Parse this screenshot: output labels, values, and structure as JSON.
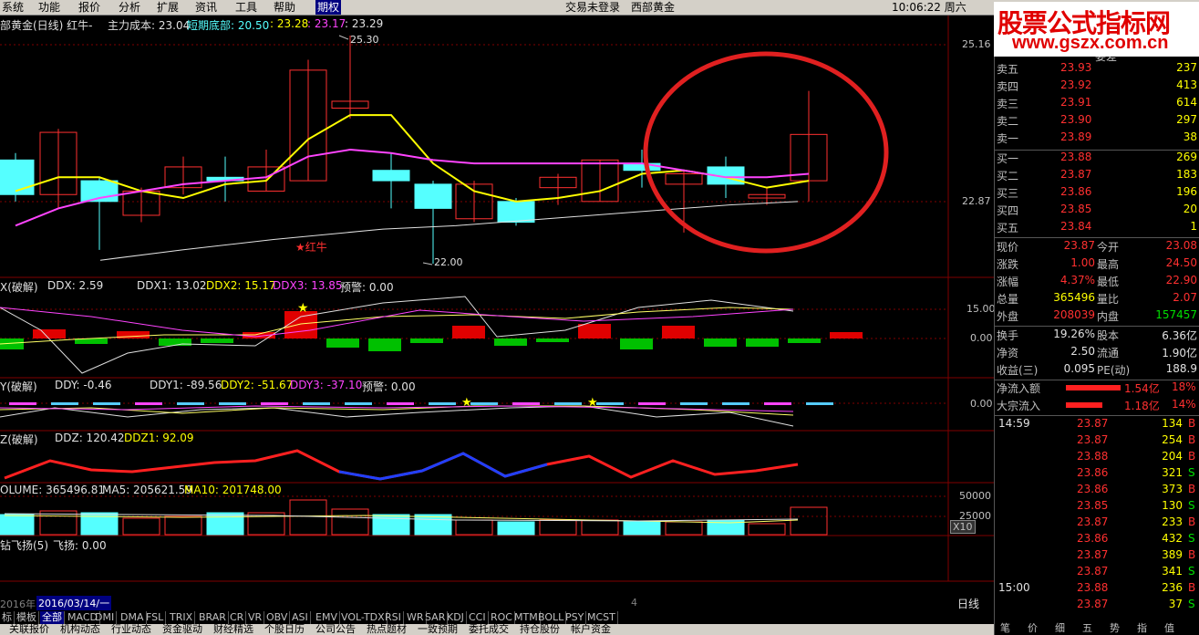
{
  "menu": {
    "items": [
      "系统",
      "功能",
      "报价",
      "分析",
      "扩展",
      "资讯",
      "工具",
      "帮助",
      "期权"
    ],
    "status": "交易未登录",
    "stock_name": "西部黄金",
    "clock": "10:06:22 周六"
  },
  "watermark": {
    "title": "股票公式指标网",
    "url": "www.gszx.com.cn"
  },
  "main_chart": {
    "title": "部黄金(日线) 红牛-",
    "cost_label": "主力成本: 23.04",
    "short_bottom_label": "短期底部: 20.50",
    "val3": ": 23.28",
    "val4": ": 23.17",
    "val5": ": 23.29",
    "high_marker": "25.30",
    "low_marker": "22.00",
    "signal_label": "★红牛",
    "axis_top": "25.16",
    "axis_mid": "22.87"
  },
  "ddx": {
    "title": "X(破解)",
    "ddx": "DDX: 2.59",
    "ddx1": "DDX1: 13.02",
    "ddx2": "DDX2: 15.17",
    "ddx3": "DDX3: 13.85",
    "warn": "预警: 0.00",
    "axis_a": "15.00",
    "axis_b": "0.00"
  },
  "ddy": {
    "title": "Y(破解)",
    "ddy": "DDY: -0.46",
    "ddy1": "DDY1: -89.56",
    "ddy2": "DDY2: -51.67",
    "ddy3": "DDY3: -37.10",
    "warn": "预警: 0.00",
    "axis_a": "0.00"
  },
  "ddz": {
    "title": "Z(破解)",
    "ddz": "DDZ: 120.42",
    "ddz1": "DDZ1: 92.09"
  },
  "volume": {
    "label": "OLUME: 365496.81",
    "ma5": "MA5: 205621.59",
    "ma10": "MA10: 201748.00",
    "axis_a": "50000",
    "axis_b": "25000",
    "axis_unit": "X10"
  },
  "feiyang": {
    "label": "钻飞扬(5)",
    "val": "飞扬: 0.00"
  },
  "date_bar": {
    "left": "2016年",
    "date": "2016/03/14/一",
    "mid": "4",
    "period": "日线"
  },
  "tabs": [
    "标",
    "模板",
    "全部",
    "MACD",
    "DMI",
    "DMA",
    "FSL",
    "TRIX",
    "BRAR",
    "CR",
    "VR",
    "OBV",
    "ASI",
    "EMV",
    "VOL-TDX",
    "RSI",
    "WR",
    "SAR",
    "KDJ",
    "CCI",
    "ROC",
    "MTM",
    "BOLL",
    "PSY",
    "MCST"
  ],
  "bottom_items": [
    "关联报价",
    "机构动态",
    "行业动态",
    "资金驱动",
    "财经精选",
    "个股日历",
    "公司公告",
    "热点题材",
    "一致预期",
    "委托成交",
    "持仓股份",
    "帐户资金"
  ],
  "order_book": {
    "header": "委差",
    "sell": [
      {
        "label": "卖五",
        "price": "23.93",
        "vol": "237"
      },
      {
        "label": "卖四",
        "price": "23.92",
        "vol": "413"
      },
      {
        "label": "卖三",
        "price": "23.91",
        "vol": "614"
      },
      {
        "label": "卖二",
        "price": "23.90",
        "vol": "297"
      },
      {
        "label": "卖一",
        "price": "23.89",
        "vol": "38"
      }
    ],
    "buy": [
      {
        "label": "买一",
        "price": "23.88",
        "vol": "269"
      },
      {
        "label": "买二",
        "price": "23.87",
        "vol": "183"
      },
      {
        "label": "买三",
        "price": "23.86",
        "vol": "196"
      },
      {
        "label": "买四",
        "price": "23.85",
        "vol": "20"
      },
      {
        "label": "买五",
        "price": "23.84",
        "vol": "1"
      }
    ]
  },
  "quote": [
    {
      "l1": "现价",
      "v1": "23.87",
      "l2": "今开",
      "v2": "23.08",
      "c1": "red",
      "c2": "red"
    },
    {
      "l1": "涨跌",
      "v1": "1.00",
      "l2": "最高",
      "v2": "24.50",
      "c1": "red",
      "c2": "red"
    },
    {
      "l1": "涨幅",
      "v1": "4.37%",
      "l2": "最低",
      "v2": "22.90",
      "c1": "red",
      "c2": "red"
    },
    {
      "l1": "总量",
      "v1": "365496",
      "l2": "量比",
      "v2": "2.07",
      "c1": "yel",
      "c2": "red"
    },
    {
      "l1": "外盘",
      "v1": "208039",
      "l2": "内盘",
      "v2": "157457",
      "c1": "red",
      "c2": "grn"
    }
  ],
  "fund": [
    {
      "l1": "换手",
      "v1": "19.26%",
      "l2": "股本",
      "v2": "6.36亿"
    },
    {
      "l1": "净资",
      "v1": "2.50",
      "l2": "流通",
      "v2": "1.90亿"
    },
    {
      "l1": "收益(三)",
      "v1": "0.095",
      "l2": "PE(动)",
      "v2": "188.9"
    }
  ],
  "flow": [
    {
      "label": "净流入额",
      "value": "1.54亿",
      "pct": "18%"
    },
    {
      "label": "大宗流入",
      "value": "1.18亿",
      "pct": "14%"
    }
  ],
  "ticks": [
    {
      "time": "14:59",
      "price": "23.87",
      "vol": "134",
      "side": "B"
    },
    {
      "time": "",
      "price": "23.87",
      "vol": "254",
      "side": "B"
    },
    {
      "time": "",
      "price": "23.88",
      "vol": "204",
      "side": "B"
    },
    {
      "time": "",
      "price": "23.86",
      "vol": "321",
      "side": "S"
    },
    {
      "time": "",
      "price": "23.86",
      "vol": "373",
      "side": "B"
    },
    {
      "time": "",
      "price": "23.85",
      "vol": "130",
      "side": "S"
    },
    {
      "time": "",
      "price": "23.87",
      "vol": "233",
      "side": "B"
    },
    {
      "time": "",
      "price": "23.86",
      "vol": "432",
      "side": "S"
    },
    {
      "time": "",
      "price": "23.87",
      "vol": "389",
      "side": "B"
    },
    {
      "time": "",
      "price": "23.87",
      "vol": "341",
      "side": "S"
    },
    {
      "time": "15:00",
      "price": "23.88",
      "vol": "236",
      "side": "B"
    },
    {
      "time": "",
      "price": "23.87",
      "vol": "37",
      "side": "S"
    }
  ],
  "right_tabs": [
    "笔",
    "价",
    "细",
    "五",
    "势",
    "指",
    "值"
  ],
  "colors": {
    "up": "#ff3030",
    "down": "#55ffff",
    "ma_yellow": "#ffff00",
    "ma_magenta": "#ff44ff",
    "circle": "#e02020"
  }
}
